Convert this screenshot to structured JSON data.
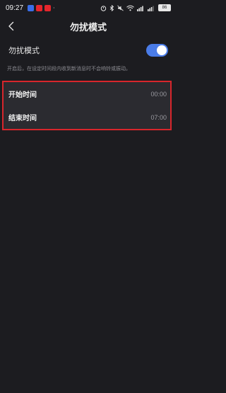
{
  "status_bar": {
    "time": "09:27",
    "battery": "86",
    "notif_colors": [
      "#3a6ee8",
      "#e6262c",
      "#e6262c"
    ]
  },
  "header": {
    "title": "勿扰模式",
    "back_icon": "chevron-left-icon"
  },
  "dnd": {
    "label": "勿扰模式",
    "enabled": true,
    "description": "开启后，在设定时间段内收到新消息时不会响铃或振动。"
  },
  "schedule": {
    "start": {
      "label": "开始时间",
      "value": "00:00"
    },
    "end": {
      "label": "结束时间",
      "value": "07:00"
    }
  },
  "colors": {
    "accent": "#4a7ce8",
    "highlight_border": "#d8262c",
    "background": "#1c1c20",
    "card": "#2b2b30"
  }
}
